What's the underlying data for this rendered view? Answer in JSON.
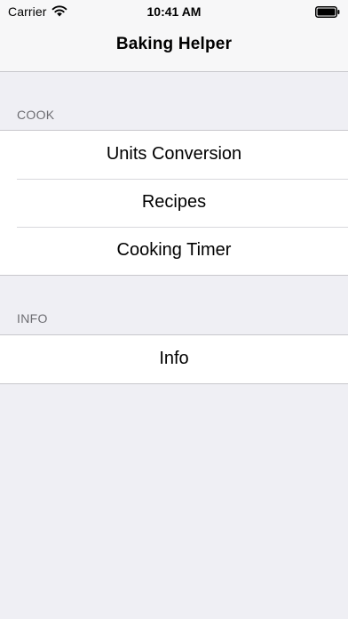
{
  "status_bar": {
    "carrier": "Carrier",
    "time": "10:41 AM",
    "wifi_icon": "wifi-icon",
    "battery_icon": "battery-icon"
  },
  "nav": {
    "title": "Baking Helper"
  },
  "sections": [
    {
      "header": "COOK",
      "items": [
        {
          "label": "Units Conversion"
        },
        {
          "label": "Recipes"
        },
        {
          "label": "Cooking Timer"
        }
      ]
    },
    {
      "header": "INFO",
      "items": [
        {
          "label": "Info"
        }
      ]
    }
  ],
  "colors": {
    "background": "#efeff4",
    "nav_background": "#f7f7f8",
    "cell_background": "#ffffff",
    "section_header_text": "#6d6d72",
    "separator": "#c8c7cc"
  }
}
